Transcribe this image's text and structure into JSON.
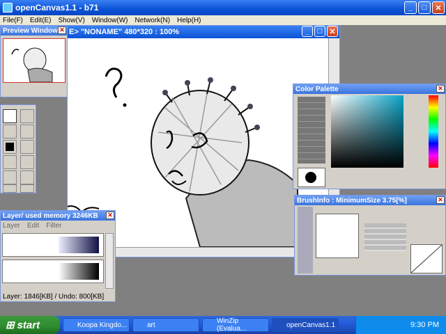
{
  "window": {
    "title": "openCanvas1.1 - b71"
  },
  "menu": [
    "File(F)",
    "Edit(E)",
    "Show(V)",
    "Window(W)",
    "Network(N)",
    "Help(H)"
  ],
  "canvas": {
    "title": "E> \"NONAME\" 480*320 : 100%"
  },
  "preview": {
    "title": "Preview Window"
  },
  "palette": {
    "title": "Color Palette"
  },
  "brush": {
    "title": "BrushInfo : MinimumSize 3.75[%]"
  },
  "layer": {
    "title": "Layer/ used memory 3246KB",
    "menu": [
      "Layer",
      "Edit",
      "Filter"
    ],
    "status": "Layer: 1846[KB] / Undo: 800[KB]"
  },
  "taskbar": {
    "start": "start",
    "tasks": [
      "Koopa Kingdo...",
      "art",
      "WinZip (Evalua...",
      "openCanvas1.1"
    ],
    "clock": "9:30 PM"
  },
  "colors": {
    "accent": "#0a53d6",
    "taskbar": "#245edb",
    "start": "#2e8b2e"
  }
}
